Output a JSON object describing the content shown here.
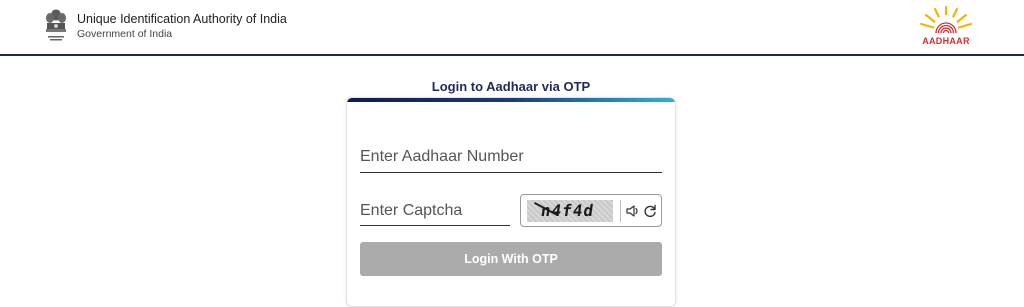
{
  "header": {
    "org_title": "Unique Identification Authority of India",
    "org_subtitle": "Government of India",
    "emblem_icon": "national-emblem-icon",
    "logo_icon": "aadhaar-logo-icon",
    "logo_text": "AADHAAR",
    "border_color": "#1e2a4a"
  },
  "login": {
    "heading": "Login to Aadhaar via OTP",
    "aadhaar_placeholder": "Enter Aadhaar Number",
    "aadhaar_value": "",
    "captcha_placeholder": "Enter Captcha",
    "captcha_value": "",
    "captcha_text": "n4f4d",
    "speaker_icon": "speaker-icon",
    "refresh_icon": "refresh-icon",
    "submit_label": "Login With OTP"
  },
  "colors": {
    "heading": "#1f2a5c",
    "button_bg": "#ababab",
    "gradient_start": "#0f1b4c",
    "gradient_end": "#2bb4d6",
    "logo_red": "#d32f2f",
    "logo_yellow": "#f2b600"
  }
}
